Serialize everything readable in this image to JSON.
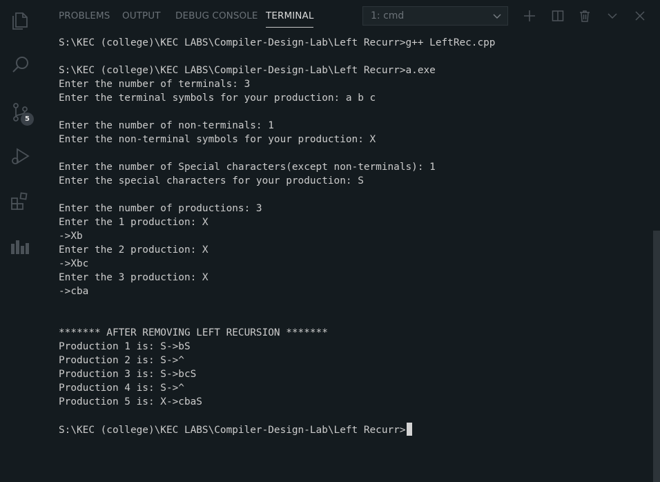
{
  "activity_bar": {
    "icons": [
      "explorer-icon",
      "search-icon",
      "source-control-icon",
      "run-debug-icon",
      "extensions-icon",
      "stats-icon"
    ],
    "source_control_badge": "5"
  },
  "panel": {
    "tabs": [
      {
        "label": "PROBLEMS",
        "active": false
      },
      {
        "label": "OUTPUT",
        "active": false
      },
      {
        "label": "DEBUG CONSOLE",
        "active": false
      },
      {
        "label": "TERMINAL",
        "active": true
      }
    ],
    "terminal_select": "1: cmd",
    "actions": [
      "add-terminal-icon",
      "split-terminal-icon",
      "kill-terminal-icon",
      "maximize-panel-icon",
      "close-panel-icon"
    ]
  },
  "terminal": {
    "lines": [
      "S:\\KEC (college)\\KEC LABS\\Compiler-Design-Lab\\Left Recurr>g++ LeftRec.cpp",
      "",
      "S:\\KEC (college)\\KEC LABS\\Compiler-Design-Lab\\Left Recurr>a.exe",
      "Enter the number of terminals: 3",
      "Enter the terminal symbols for your production: a b c",
      "",
      "Enter the number of non-terminals: 1",
      "Enter the non-terminal symbols for your production: X",
      "",
      "Enter the number of Special characters(except non-terminals): 1",
      "Enter the special characters for your production: S",
      "",
      "Enter the number of productions: 3",
      "Enter the 1 production: X",
      "->Xb",
      "Enter the 2 production: X",
      "->Xbc",
      "Enter the 3 production: X",
      "->cba",
      "",
      "",
      "******* AFTER REMOVING LEFT RECURSION *******",
      "Production 1 is: S->bS",
      "Production 2 is: S->^",
      "Production 3 is: S->bcS",
      "Production 4 is: S->^",
      "Production 5 is: X->cbaS",
      ""
    ],
    "prompt": "S:\\KEC (college)\\KEC LABS\\Compiler-Design-Lab\\Left Recurr>"
  }
}
